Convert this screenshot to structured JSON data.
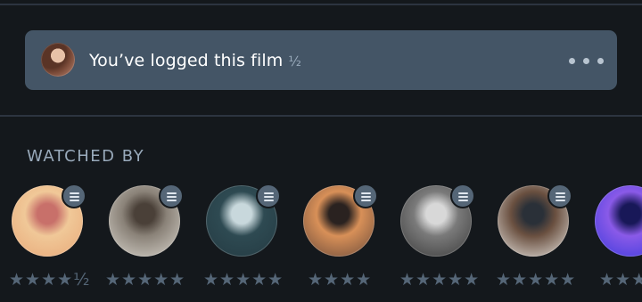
{
  "logged": {
    "text": "You’ve logged this film",
    "rating": "½"
  },
  "watched_by": {
    "heading": "WATCHED BY",
    "members": [
      {
        "avatar": "cartoon-princess",
        "rating": "★★★★½",
        "colors": [
          "#e8a878",
          "#f0c898",
          "#c8706a"
        ]
      },
      {
        "avatar": "man-in-suit",
        "rating": "★★★★★",
        "colors": [
          "#d8d4cc",
          "#8a8278",
          "#4a4038"
        ]
      },
      {
        "avatar": "views-of-cinema-logo",
        "rating": "★★★★★",
        "colors": [
          "#243a42",
          "#2e4a52",
          "#c8d8dc"
        ]
      },
      {
        "avatar": "woman-orange-jumpsuit",
        "rating": "★★★★",
        "colors": [
          "#6a4a3a",
          "#d89058",
          "#2a2220"
        ]
      },
      {
        "avatar": "camera-operator",
        "rating": "★★★★★",
        "colors": [
          "#3a3a3a",
          "#7a7a7a",
          "#d8d8d8"
        ]
      },
      {
        "avatar": "masked-man",
        "rating": "★★★★★",
        "colors": [
          "#e8e6e2",
          "#6a5040",
          "#2a3038"
        ]
      },
      {
        "avatar": "blue-stage",
        "rating": "★★★",
        "colors": [
          "#3a3adc",
          "#8a5ae8",
          "#181858"
        ]
      }
    ]
  }
}
